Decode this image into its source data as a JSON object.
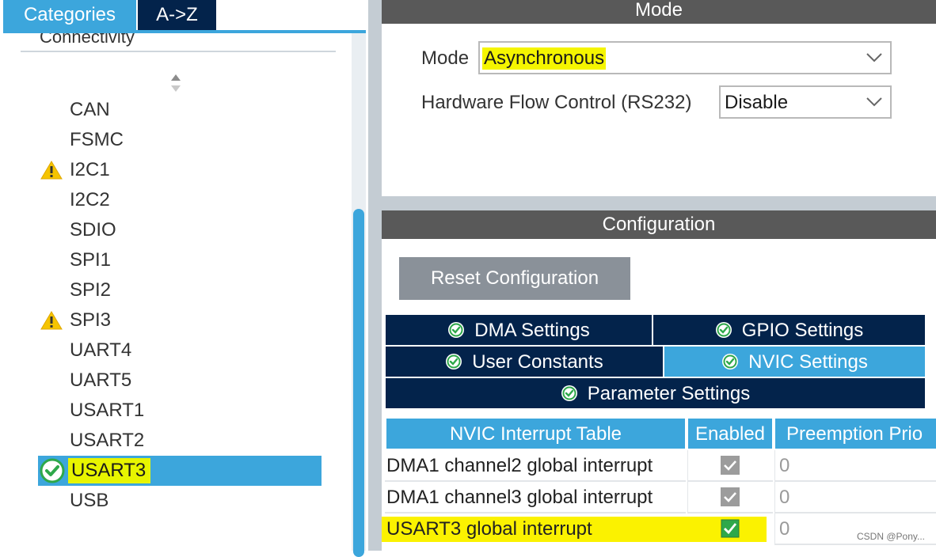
{
  "left_panel": {
    "tabs": [
      "Categories",
      "A->Z"
    ],
    "group_title": "Connectivity",
    "items": [
      {
        "label": "CAN",
        "status": "none"
      },
      {
        "label": "FSMC",
        "status": "none"
      },
      {
        "label": "I2C1",
        "status": "warning"
      },
      {
        "label": "I2C2",
        "status": "none"
      },
      {
        "label": "SDIO",
        "status": "none"
      },
      {
        "label": "SPI1",
        "status": "none"
      },
      {
        "label": "SPI2",
        "status": "none"
      },
      {
        "label": "SPI3",
        "status": "warning"
      },
      {
        "label": "UART4",
        "status": "none"
      },
      {
        "label": "UART5",
        "status": "none"
      },
      {
        "label": "USART1",
        "status": "none"
      },
      {
        "label": "USART2",
        "status": "none"
      },
      {
        "label": "USART3",
        "status": "ok",
        "selected": true
      },
      {
        "label": "USB",
        "status": "none"
      }
    ]
  },
  "mode_section": {
    "header": "Mode",
    "mode_label": "Mode",
    "mode_value": "Asynchronous",
    "flow_label": "Hardware Flow Control (RS232)",
    "flow_value": "Disable"
  },
  "config_section": {
    "header": "Configuration",
    "reset_label": "Reset Configuration",
    "tabs": {
      "dma": "DMA Settings",
      "gpio": "GPIO Settings",
      "user": "User Constants",
      "nvic": "NVIC Settings",
      "param": "Parameter Settings"
    },
    "active_tab": "NVIC Settings"
  },
  "nvic_table": {
    "headers": [
      "NVIC Interrupt Table",
      "Enabled",
      "Preemption Prio"
    ],
    "rows": [
      {
        "name": "DMA1 channel2 global interrupt",
        "enabled": true,
        "priority": "0",
        "editable": false
      },
      {
        "name": "DMA1 channel3 global interrupt",
        "enabled": true,
        "priority": "0",
        "editable": false
      },
      {
        "name": "USART3 global interrupt",
        "enabled": true,
        "priority": "0",
        "editable": true,
        "highlighted": true
      }
    ]
  },
  "watermark": "CSDN @Pony...",
  "colors": {
    "accent": "#3ca6dc",
    "navy": "#03234b",
    "header_gray": "#595959",
    "highlight": "#f5f500",
    "ok_green": "#2ea84a",
    "warning": "#f5c400"
  }
}
